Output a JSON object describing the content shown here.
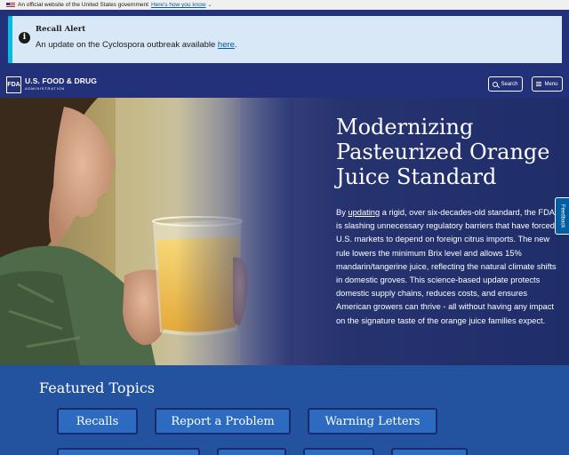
{
  "gov_banner": {
    "text": "An official website of the United States government",
    "link": "Here's how you know"
  },
  "alert": {
    "title": "Recall Alert",
    "body": "An update on the Cyclospora outbreak available",
    "link": "here",
    "suffix": "."
  },
  "header": {
    "logo_abbr": "FDA",
    "logo_main": "U.S. FOOD & DRUG",
    "logo_sub": "ADMINISTRATION",
    "search_label": "Search",
    "menu_label": "Menu"
  },
  "hero": {
    "title": "Modernizing Pasteurized Orange Juice Standard",
    "desc_prefix": "By ",
    "desc_link": "updating",
    "desc_rest": " a rigid, over six-decades-old standard, the FDA is slashing unnecessary regulatory barriers that have forced U.S. markets to depend on foreign citrus imports. The new rule lowers the minimum Brix level and allows 15% mandarin/tangerine juice, reflecting the natural climate shifts in domestic groves. This science-based update protects domestic supply chains, reduces costs, and ensures American growers can thrive - all without having any impact on the signature taste of the orange juice families expect."
  },
  "feedback_label": "Feedback",
  "featured": {
    "title": "Featured Topics",
    "topics": [
      "Recalls",
      "Report a Problem",
      "Warning Letters"
    ]
  },
  "colors": {
    "navy": "#23307a",
    "alert_bg": "#d9e8f6",
    "alert_accent": "#00bde3",
    "featured_bg": "#23539e",
    "topic_bg": "#2c6bc0"
  }
}
